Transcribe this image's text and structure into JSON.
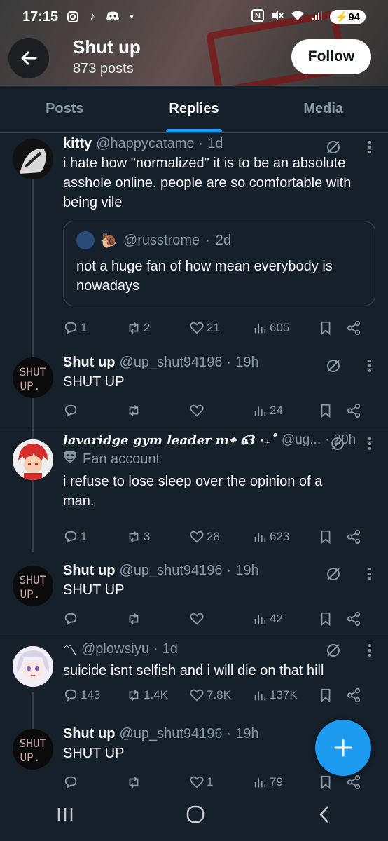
{
  "status_bar": {
    "time": "17:15",
    "battery": "94"
  },
  "header": {
    "title": "Shut up",
    "subtitle": "873 posts",
    "follow_label": "Follow"
  },
  "tabs": [
    {
      "label": "Posts",
      "active": false
    },
    {
      "label": "Replies",
      "active": true
    },
    {
      "label": "Media",
      "active": false
    }
  ],
  "tweets": [
    {
      "name": "kitty",
      "handle": "@happycatame",
      "time": "1d",
      "text": "i hate how \"normalized\" it is to be an absolute asshole online. people are so comfortable with being vile",
      "quote": {
        "handle": "@russtrome",
        "time": "2d",
        "text": "not a huge fan of how mean everybody is nowadays"
      },
      "replies": "1",
      "reposts": "2",
      "likes": "21",
      "views": "605"
    },
    {
      "name": "Shut up",
      "handle": "@up_shut94196",
      "time": "19h",
      "text": "SHUT UP",
      "replies": "",
      "reposts": "",
      "likes": "",
      "views": "24"
    },
    {
      "name": "lavaridge gym leader m⌖ 𝟔3 ·₊˚",
      "handle": "@ug...",
      "time": "20h",
      "label": "Fan account",
      "text": "i refuse to lose sleep over the opinion of a man.",
      "replies": "1",
      "reposts": "3",
      "likes": "28",
      "views": "623"
    },
    {
      "name": "Shut up",
      "handle": "@up_shut94196",
      "time": "19h",
      "text": "SHUT UP",
      "replies": "",
      "reposts": "",
      "likes": "",
      "views": "42"
    },
    {
      "name": "〽",
      "handle": "@plowsiyu",
      "time": "1d",
      "text": "suicide isnt selfish and i will die on that hill",
      "replies": "143",
      "reposts": "1.4K",
      "likes": "7.8K",
      "views": "137K"
    },
    {
      "name": "Shut up",
      "handle": "@up_shut94196",
      "time": "19h",
      "text": "SHUT UP",
      "replies": "",
      "reposts": "",
      "likes": "1",
      "views": "79"
    }
  ],
  "avatar_text": {
    "line1": "SHUT",
    "line2": "UP."
  },
  "colors": {
    "background": "#15202b",
    "accent": "#1d9bf0",
    "muted": "#8b98a5",
    "border": "#38444d"
  }
}
